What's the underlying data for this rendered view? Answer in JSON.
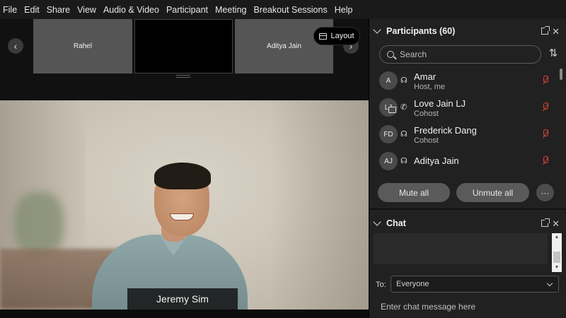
{
  "menu": [
    "File",
    "Edit",
    "Share",
    "View",
    "Audio & Video",
    "Participant",
    "Meeting",
    "Breakout Sessions",
    "Help"
  ],
  "filmstrip": {
    "tiles": [
      "Rahel",
      "",
      "Aditya Jain"
    ],
    "layout_label": "Layout"
  },
  "video": {
    "speaker_name": "Jeremy Sim"
  },
  "participants": {
    "title": "Participants (60)",
    "search_placeholder": "Search",
    "list": [
      {
        "initials": "A",
        "name": "Amar",
        "role": "Host, me",
        "audio": "headset-icon"
      },
      {
        "initials": "LJ",
        "name": "Love Jain LJ",
        "role": "Cohost",
        "audio": "phone-icon"
      },
      {
        "initials": "FD",
        "name": "Frederick Dang",
        "role": "Cohost",
        "audio": "headset-icon"
      },
      {
        "initials": "AJ",
        "name": "Aditya Jain",
        "role": "",
        "audio": "headset-icon"
      }
    ],
    "mute_all": "Mute all",
    "unmute_all": "Unmute all",
    "more": "···"
  },
  "chat": {
    "title": "Chat",
    "to_label": "To:",
    "to_value": "Everyone",
    "input_placeholder": "Enter chat message here"
  },
  "colors": {
    "muted_mic": "#e0453a",
    "panel_bg": "#212121",
    "pill_bg": "#5a5a5a"
  }
}
